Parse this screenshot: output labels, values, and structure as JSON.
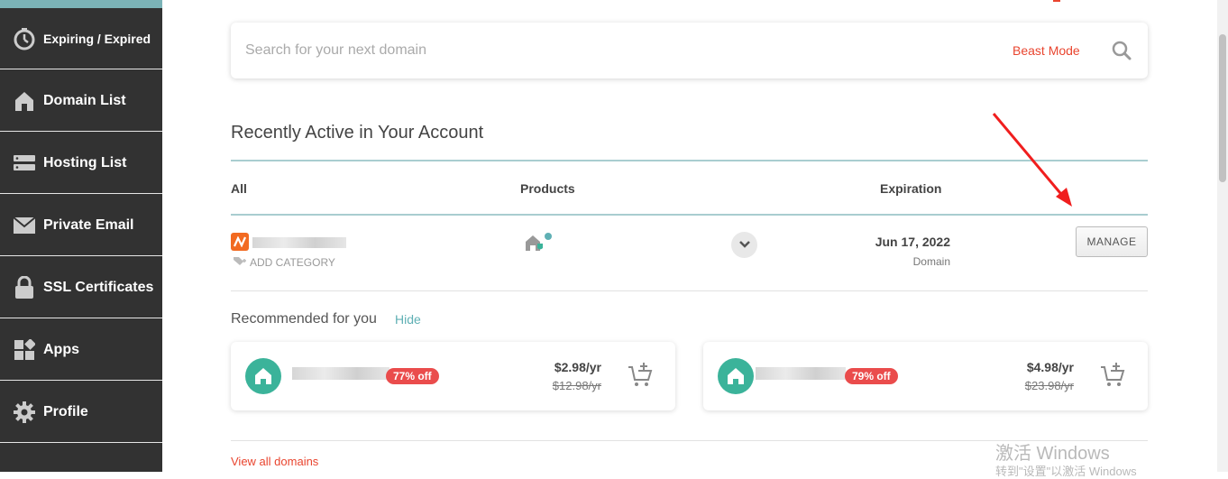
{
  "sidebar": {
    "items": [
      {
        "label": "Expiring / Expired",
        "icon": "stopwatch-icon"
      },
      {
        "label": "Domain List",
        "icon": "house-icon"
      },
      {
        "label": "Hosting List",
        "icon": "server-icon"
      },
      {
        "label": "Private Email",
        "icon": "envelope-icon"
      },
      {
        "label": "SSL Certificates",
        "icon": "lock-icon"
      },
      {
        "label": "Apps",
        "icon": "apps-grid-icon"
      },
      {
        "label": "Profile",
        "icon": "gear-icon"
      }
    ]
  },
  "search": {
    "placeholder": "Search for your next domain",
    "beast_mode": "Beast Mode",
    "icon": "search-icon"
  },
  "recent": {
    "title": "Recently Active in Your Account",
    "columns": {
      "all": "All",
      "products": "Products",
      "expiration": "Expiration"
    },
    "row": {
      "add_category": "ADD CATEGORY",
      "expiration_date": "Jun 17, 2022",
      "expiration_type": "Domain",
      "manage_label": "MANAGE"
    }
  },
  "recommended": {
    "title": "Recommended for you",
    "hide_label": "Hide",
    "cards": [
      {
        "discount": "77% off",
        "price": "$2.98/yr",
        "old_price": "$12.98/yr"
      },
      {
        "discount": "79% off",
        "price": "$4.98/yr",
        "old_price": "$23.98/yr"
      }
    ]
  },
  "footer": {
    "view_all": "View all domains"
  },
  "watermark": {
    "line1": "激活 Windows",
    "line2": "转到\"设置\"以激活 Windows"
  },
  "colors": {
    "accent_red": "#e9452f",
    "teal": "#5fb0b4",
    "sidebar_bg": "#323232",
    "badge_red": "#ea4c4c",
    "house_green": "#3bb39a"
  }
}
